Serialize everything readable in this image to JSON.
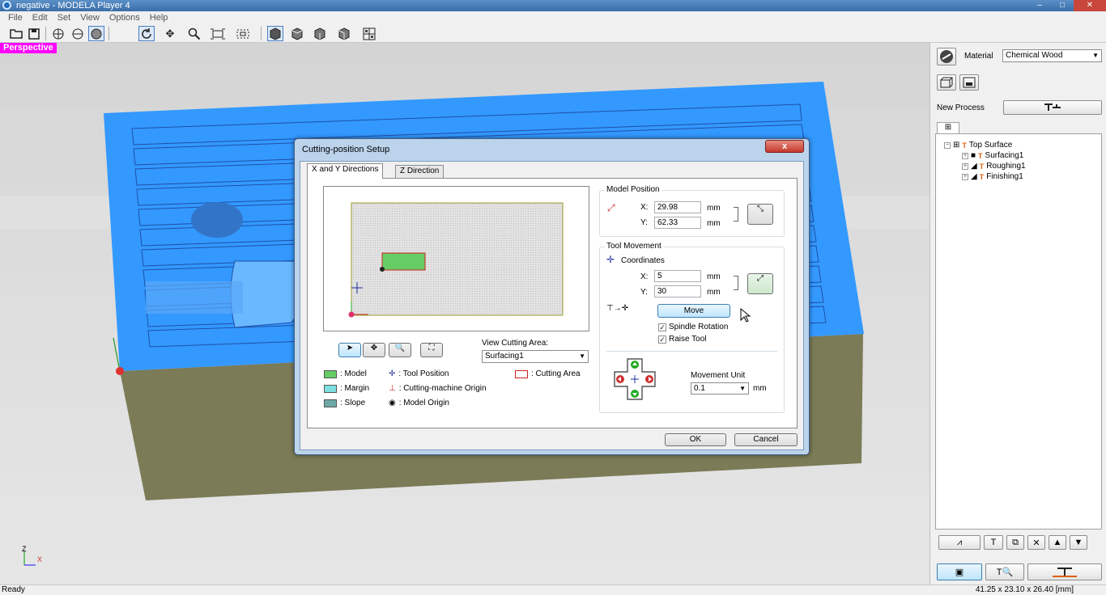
{
  "window": {
    "title": "negative - MODELA Player 4",
    "minimize": "–",
    "maximize": "□",
    "close": "✕"
  },
  "menu": [
    "File",
    "Edit",
    "Set",
    "View",
    "Options",
    "Help"
  ],
  "viewport": {
    "label": "Perspective",
    "axis_z": "Z",
    "axis_x": "X"
  },
  "right_panel": {
    "material_label": "Material",
    "material_value": "Chemical Wood",
    "new_process_label": "New Process",
    "tree": {
      "root": "Top Surface",
      "items": [
        "Surfacing1",
        "Roughing1",
        "Finishing1"
      ]
    }
  },
  "dialog": {
    "title": "Cutting-position Setup",
    "close": "x",
    "tabs": [
      "X and Y Directions",
      "Z Direction"
    ],
    "view_cutting_area_label": "View Cutting Area:",
    "view_cutting_area_value": "Surfacing1",
    "legend": {
      "model": ": Model",
      "margin": ": Margin",
      "slope": ": Slope",
      "tool_position": ": Tool Position",
      "cm_origin": ": Cutting-machine Origin",
      "model_origin": ": Model Origin",
      "cutting_area": ": Cutting Area"
    },
    "model_position": {
      "title": "Model Position",
      "x_label": "X:",
      "x_value": "29.98",
      "x_unit": "mm",
      "y_label": "Y:",
      "y_value": "62.33",
      "y_unit": "mm"
    },
    "tool_movement": {
      "title": "Tool Movement",
      "coordinates_label": "Coordinates",
      "x_label": "X:",
      "x_value": "5",
      "x_unit": "mm",
      "y_label": "Y:",
      "y_value": "30",
      "y_unit": "mm",
      "move_button": "Move",
      "spindle_rotation": "Spindle Rotation",
      "raise_tool": "Raise Tool",
      "movement_unit_label": "Movement Unit",
      "movement_unit_value": "0.1",
      "movement_unit_suffix": "mm"
    },
    "ok": "OK",
    "cancel": "Cancel"
  },
  "status": {
    "left": "Ready",
    "right": "41.25 x 23.10 x 26.40 [mm]"
  },
  "colors": {
    "model_blue": "#3399ff",
    "base_olive": "#7b7b58",
    "model_green": "#66cc66",
    "margin_cyan": "#7fe0e0",
    "slope_teal": "#6fa8a8"
  }
}
